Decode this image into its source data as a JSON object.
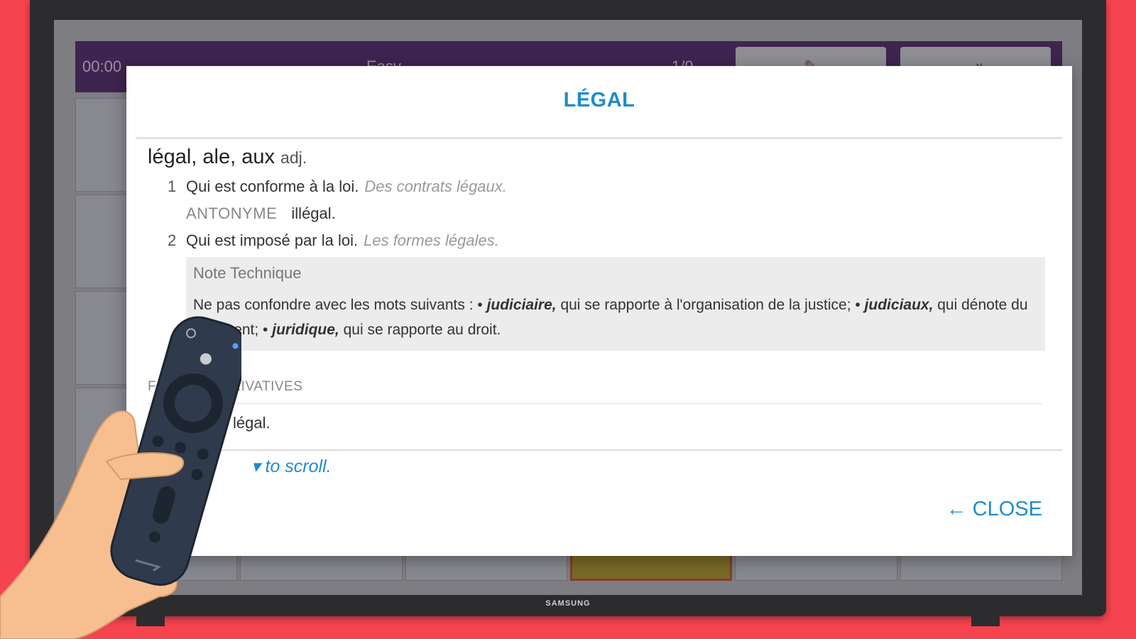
{
  "tv": {
    "brand": "SAMSUNG"
  },
  "game": {
    "timer": "00:00",
    "level": "Easy",
    "score": "1/9",
    "buttons": [
      "pencil-icon",
      "exit-icon"
    ]
  },
  "modal": {
    "title": "LÉGAL",
    "headword": "légal, ale, aux",
    "pos": "adj.",
    "senses": [
      {
        "num": "1",
        "text": "Qui est conforme à la loi.",
        "example": "Des contrats légaux."
      },
      {
        "num": "2",
        "text": "Qui est imposé par la loi.",
        "example": "Les formes légales."
      }
    ],
    "antonym": {
      "label": "ANTONYME",
      "value": "illégal."
    },
    "note": {
      "title": "Note Technique",
      "intro": "Ne pas confondre avec les mots suivants : • ",
      "w1": "judiciaire,",
      "t1": " qui se rapporte à l'organisation de la justice; • ",
      "w2": "judiciaux,",
      "t2": " qui dénote du jugement; • ",
      "w3": "juridique,",
      "t3": " qui se rapporte au droit."
    },
    "section": {
      "title": "FORMES DÉRIVATIVES",
      "item": "légal."
    },
    "scroll_hint": "to scroll.",
    "close_label": "CLOSE"
  },
  "colors": {
    "accent": "#1f8ccd",
    "background": "#f5434f",
    "header": "#3e2450"
  }
}
